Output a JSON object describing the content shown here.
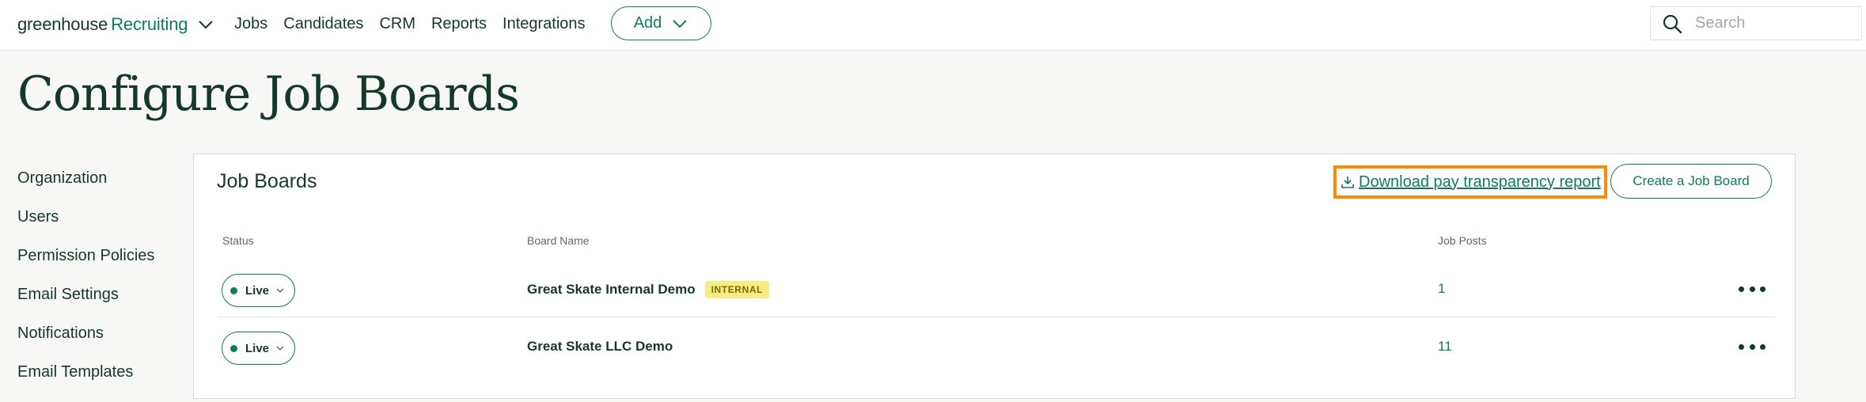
{
  "brand": {
    "name": "greenhouse",
    "product": "Recruiting"
  },
  "nav": {
    "items": [
      "Jobs",
      "Candidates",
      "CRM",
      "Reports",
      "Integrations"
    ],
    "add_label": "Add"
  },
  "search": {
    "placeholder": "Search",
    "value": ""
  },
  "page": {
    "title": "Configure Job Boards"
  },
  "sidebar": {
    "items": [
      {
        "label": "Organization"
      },
      {
        "label": "Users"
      },
      {
        "label": "Permission Policies"
      },
      {
        "label": "Email Settings"
      },
      {
        "label": "Notifications"
      },
      {
        "label": "Email Templates"
      }
    ]
  },
  "card": {
    "title": "Job Boards",
    "download_label": "Download pay transparency report",
    "create_label": "Create a Job Board",
    "columns": {
      "status": "Status",
      "board_name": "Board Name",
      "job_posts": "Job Posts"
    },
    "rows": [
      {
        "status": "Live",
        "board_name": "Great Skate Internal Demo",
        "badge": "INTERNAL",
        "job_posts": "1"
      },
      {
        "status": "Live",
        "board_name": "Great Skate LLC Demo",
        "badge": "",
        "job_posts": "11"
      }
    ]
  },
  "colors": {
    "brand_green": "#0f7b5c",
    "dark_text": "#15372c",
    "highlight": "#ff8a00",
    "badge_bg": "#f5ec85"
  }
}
